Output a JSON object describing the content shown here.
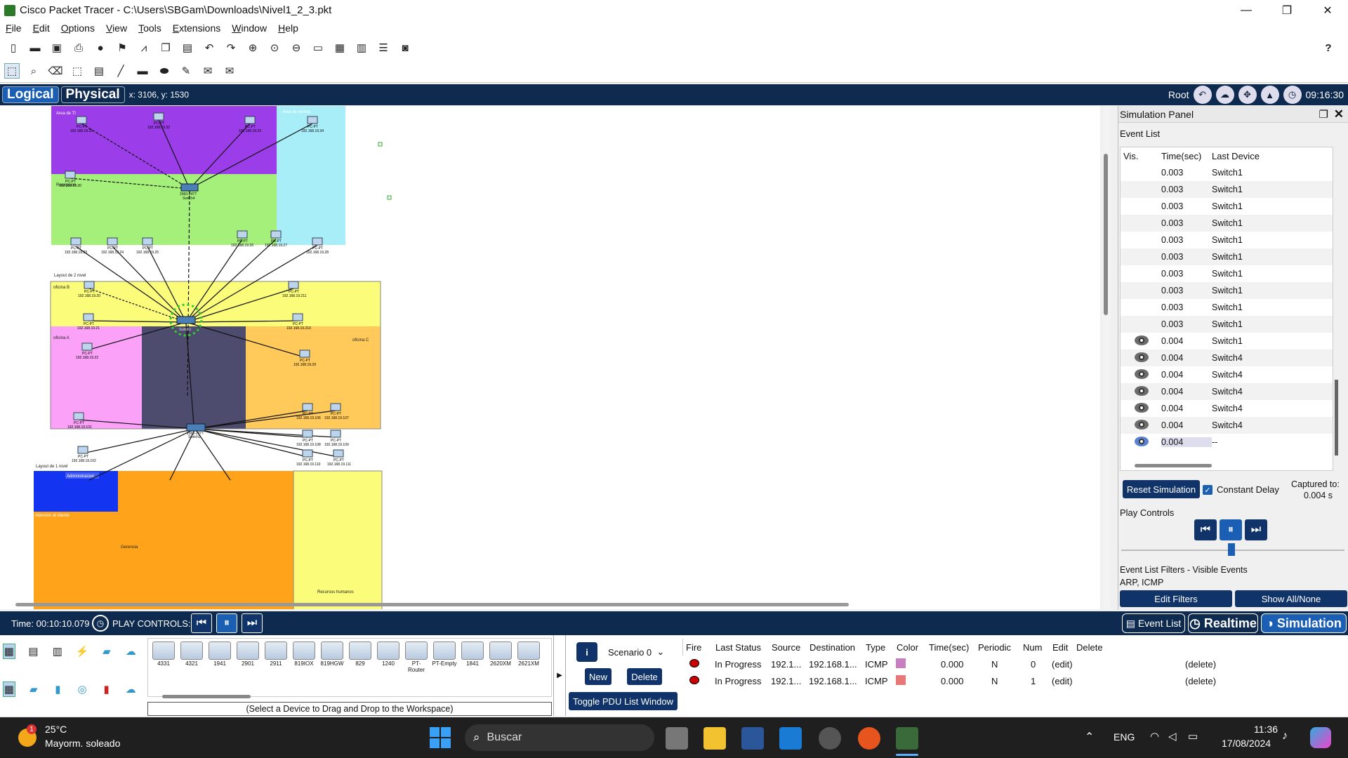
{
  "window": {
    "title": "Cisco Packet Tracer - C:\\Users\\SBGam\\Downloads\\Nivel1_2_3.pkt",
    "min": "—",
    "max": "❐",
    "close": "✕"
  },
  "menu": [
    "File",
    "Edit",
    "Options",
    "View",
    "Tools",
    "Extensions",
    "Window",
    "Help"
  ],
  "help_icon": "?",
  "modes": {
    "logical": "Logical",
    "physical": "Physical",
    "coords": "x: 3106, y: 1530"
  },
  "topright": {
    "root": "Root",
    "clock": "09:16:30"
  },
  "diagram": {
    "areas": [
      {
        "label": "Area de TI"
      },
      {
        "label": "Area de ventas"
      },
      {
        "label": "Recepcion"
      },
      {
        "label": "Layout de 2 nivel"
      },
      {
        "label": "oficina B"
      },
      {
        "label": "oficina A"
      },
      {
        "label": "oficina C"
      },
      {
        "label": "Layout de 1 nivel"
      },
      {
        "label": "Administracion"
      },
      {
        "label": "Atencion al cliente"
      },
      {
        "label": "Gerencia"
      },
      {
        "label": "Recursos humanos"
      }
    ],
    "pcs": [
      {
        "name": "PC-PT",
        "ip": "192.168.19.31"
      },
      {
        "name": "PC-PT",
        "ip": "192.168.19.32"
      },
      {
        "name": "PC-PT",
        "ip": "192.168.19.33"
      },
      {
        "name": "PC-PT",
        "ip": "192.168.19.34"
      },
      {
        "name": "PC-PT",
        "ip": "192.168.19.30"
      },
      {
        "name": "PC-PT",
        "ip": "192.168.19.23"
      },
      {
        "name": "PC-PT",
        "ip": "192.168.19.24"
      },
      {
        "name": "PC-PT",
        "ip": "192.168.19.25"
      },
      {
        "name": "PC-PT",
        "ip": "192.168.19.26"
      },
      {
        "name": "PC-PT",
        "ip": "192.168.19.27"
      },
      {
        "name": "PC-PT",
        "ip": "192.168.19.28"
      },
      {
        "name": "PC-PT",
        "ip": "192.168.19.20"
      },
      {
        "name": "PC-PT",
        "ip": "192.168.19.21"
      },
      {
        "name": "PC-PT",
        "ip": "192.168.19.22"
      },
      {
        "name": "PC-PT",
        "ip": "192.168.19.211"
      },
      {
        "name": "PC-PT",
        "ip": "192.168.19.210"
      },
      {
        "name": "PC-PT",
        "ip": "192.168.19.29"
      },
      {
        "name": "PC-PT",
        "ip": "192.168.19.101"
      },
      {
        "name": "PC-PT",
        "ip": "192.168.19.102"
      },
      {
        "name": "PC-PT",
        "ip": "192.168.19.106"
      },
      {
        "name": "PC-PT",
        "ip": "192.168.19.107"
      },
      {
        "name": "PC-PT",
        "ip": "192.168.19.108"
      },
      {
        "name": "PC-PT",
        "ip": "192.168.19.109"
      },
      {
        "name": "PC-PT",
        "ip": "192.168.19.110"
      },
      {
        "name": "PC-PT",
        "ip": "192.168.19.111"
      }
    ],
    "switches": [
      {
        "model": "2960-24TT",
        "name": "Switch4"
      },
      {
        "model": "",
        "name": "Switch1"
      },
      {
        "model": "2960-24TT",
        "name": "Switch3"
      }
    ]
  },
  "sim_panel": {
    "title": "Simulation Panel",
    "event_list_label": "Event List",
    "columns": [
      "Vis.",
      "Time(sec)",
      "Last Device"
    ],
    "events": [
      {
        "vis": false,
        "time": "0.003",
        "device": "Switch1"
      },
      {
        "vis": false,
        "time": "0.003",
        "device": "Switch1"
      },
      {
        "vis": false,
        "time": "0.003",
        "device": "Switch1"
      },
      {
        "vis": false,
        "time": "0.003",
        "device": "Switch1"
      },
      {
        "vis": false,
        "time": "0.003",
        "device": "Switch1"
      },
      {
        "vis": false,
        "time": "0.003",
        "device": "Switch1"
      },
      {
        "vis": false,
        "time": "0.003",
        "device": "Switch1"
      },
      {
        "vis": false,
        "time": "0.003",
        "device": "Switch1"
      },
      {
        "vis": false,
        "time": "0.003",
        "device": "Switch1"
      },
      {
        "vis": false,
        "time": "0.003",
        "device": "Switch1"
      },
      {
        "vis": true,
        "time": "0.004",
        "device": "Switch1"
      },
      {
        "vis": true,
        "time": "0.004",
        "device": "Switch4"
      },
      {
        "vis": true,
        "time": "0.004",
        "device": "Switch4"
      },
      {
        "vis": true,
        "time": "0.004",
        "device": "Switch4"
      },
      {
        "vis": true,
        "time": "0.004",
        "device": "Switch4"
      },
      {
        "vis": true,
        "time": "0.004",
        "device": "Switch4"
      },
      {
        "vis": true,
        "time": "0.004",
        "device": "--"
      }
    ],
    "reset_label": "Reset Simulation",
    "constant_delay": "Constant Delay",
    "captured_label": "Captured to:",
    "captured_value": "0.004 s",
    "play_controls_label": "Play Controls",
    "filters_label": "Event List Filters - Visible Events",
    "filters_value": "ARP, ICMP",
    "edit_filters": "Edit Filters",
    "show_all": "Show All/None"
  },
  "bottom": {
    "time": "Time: 00:10:10.079",
    "play_controls": "PLAY CONTROLS:",
    "event_list_btn": "Event List",
    "realtime": "Realtime",
    "simulation": "Simulation"
  },
  "devices": [
    "4331",
    "4321",
    "1941",
    "2901",
    "2911",
    "819IOX",
    "819HGW",
    "829",
    "1240",
    "PT-Router",
    "PT-Empty",
    "1841",
    "2620XM",
    "2621XM"
  ],
  "device_hint": "(Select a Device to Drag and Drop to the Workspace)",
  "scenario": {
    "selected": "Scenario 0",
    "new": "New",
    "delete": "Delete",
    "toggle": "Toggle PDU List Window",
    "info": "i"
  },
  "pdu": {
    "columns": [
      "Fire",
      "Last Status",
      "Source",
      "Destination",
      "Type",
      "Color",
      "Time(sec)",
      "Periodic",
      "Num",
      "Edit",
      "Delete"
    ],
    "rows": [
      {
        "status": "In Progress",
        "source": "192.1...",
        "destination": "192.168.1...",
        "type": "ICMP",
        "color": "#c77fc0",
        "time": "0.000",
        "periodic": "N",
        "num": "0",
        "edit": "(edit)",
        "delete": "(delete)"
      },
      {
        "status": "In Progress",
        "source": "192.1...",
        "destination": "192.168.1...",
        "type": "ICMP",
        "color": "#e87878",
        "time": "0.000",
        "periodic": "N",
        "num": "1",
        "edit": "(edit)",
        "delete": "(delete)"
      }
    ]
  },
  "taskbar": {
    "badge": "1",
    "temp": "25°C",
    "weather": "Mayorm. soleado",
    "search": "Buscar",
    "lang": "ENG",
    "time": "11:36",
    "date": "17/08/2024"
  },
  "colors": {
    "accent": "#1a5fb4",
    "bar": "#0e2a4f",
    "btn": "#10336a"
  }
}
